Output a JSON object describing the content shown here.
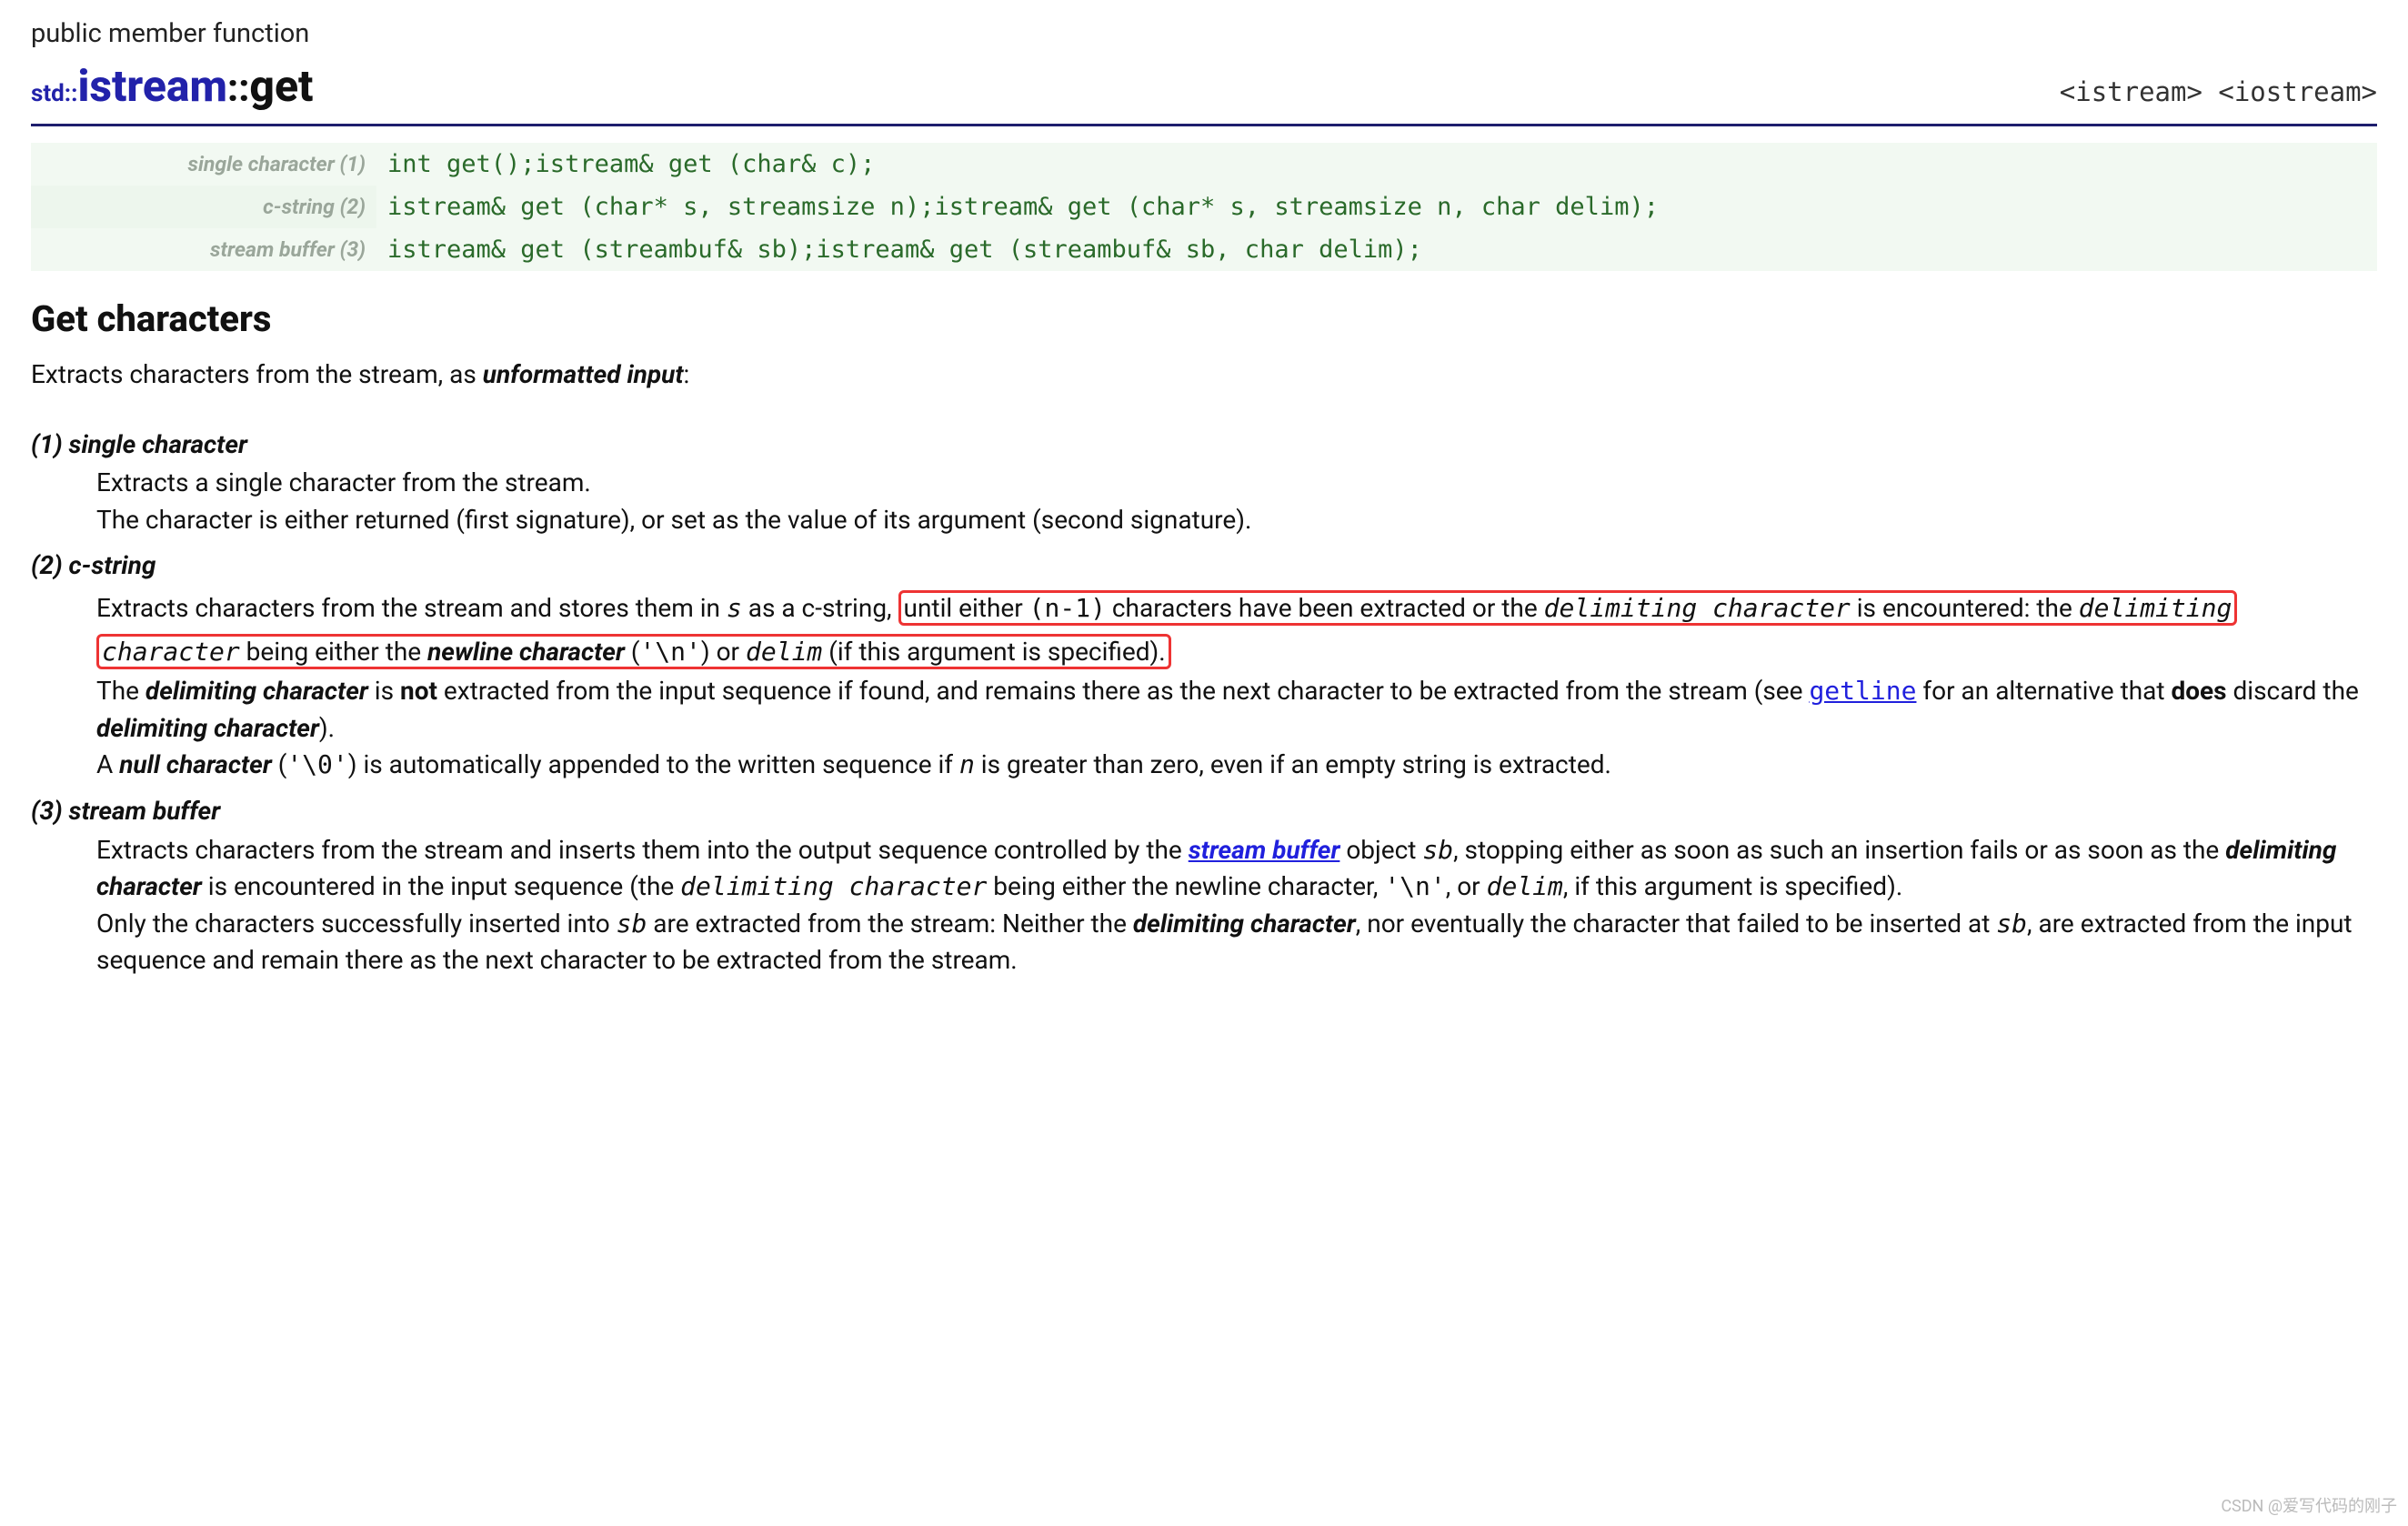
{
  "kind": "public member function",
  "title": {
    "namespace": "std::",
    "class": "istream",
    "separator": "::",
    "function": "get"
  },
  "headers": "<istream> <iostream>",
  "signatures": [
    {
      "label": "single character (1)",
      "code": "int get();istream& get (char& c);"
    },
    {
      "label": "c-string (2)",
      "code": "istream& get (char* s, streamsize n);istream& get (char* s, streamsize n, char delim);"
    },
    {
      "label": "stream buffer (3)",
      "code": "istream& get (streambuf& sb);istream& get (streambuf& sb, char delim);"
    }
  ],
  "section_title": "Get characters",
  "intro": {
    "p1a": "Extracts characters from the stream, as ",
    "p1b": "unformatted input",
    "p1c": ":"
  },
  "def1": {
    "head": "(1) single character",
    "l1": "Extracts a single character from the stream.",
    "l2": "The character is either returned (first signature), or set as the value of its argument (second signature)."
  },
  "def2": {
    "head": "(2) c-string",
    "p1a": "Extracts characters from the stream and stores them in ",
    "p1_s": "s",
    "p1b": " as a c-string, ",
    "hl_a": "until either ",
    "hl_n1": "(n-1)",
    "hl_b": " characters have been extracted or the ",
    "hl_dc1": "delimiting character",
    "hl_c": " is encountered: the ",
    "hl_dc2": "delimiting character",
    "hl_d": " being either the ",
    "hl_nc": "newline character",
    "hl_e": " (",
    "hl_nl": "'\\n'",
    "hl_f": ") or ",
    "hl_delim": "delim",
    "hl_g": " (if this argument is specified).",
    "p2a": "The ",
    "p2_dc": "delimiting character",
    "p2b": " is ",
    "p2_not": "not",
    "p2c": " extracted from the input sequence if found, and remains there as the next character to be extracted from the stream (see ",
    "p2_link": "getline",
    "p2d": " for an alternative that ",
    "p2_does": "does",
    "p2e": " discard the ",
    "p2_dc2": "delimiting character",
    "p2f": ").",
    "p3a": "A ",
    "p3_nc": "null character",
    "p3b": " (",
    "p3_nul": "'\\0'",
    "p3c": ") is automatically appended to the written sequence if ",
    "p3_n": "n",
    "p3d": " is greater than zero, even if an empty string is extracted."
  },
  "def3": {
    "head": "(3) stream buffer",
    "p1a": "Extracts characters from the stream and inserts them into the output sequence controlled by the ",
    "p1_link": "stream buffer",
    "p1b": " object ",
    "p1_sb": "sb",
    "p1c": ", stopping either as soon as such an insertion fails or as soon as the ",
    "p1_dc": "delimiting character",
    "p1d": " is encountered in the input sequence (the ",
    "p1_dc2": "delimiting character",
    "p1e": " being either the newline character, ",
    "p1_nl": "'\\n'",
    "p1f": ", or ",
    "p1_delim": "delim",
    "p1g": ", if this argument is specified).",
    "p2a": "Only the characters successfully inserted into ",
    "p2_sb": "sb",
    "p2b": " are extracted from the stream: Neither the ",
    "p2_dc": "delimiting character",
    "p2c": ", nor eventually the character that failed to be inserted at ",
    "p2_sb2": "sb",
    "p2d": ", are extracted from the input sequence and remain there as the next character to be extracted from the stream."
  },
  "watermark": "CSDN @爱写代码的刚子"
}
